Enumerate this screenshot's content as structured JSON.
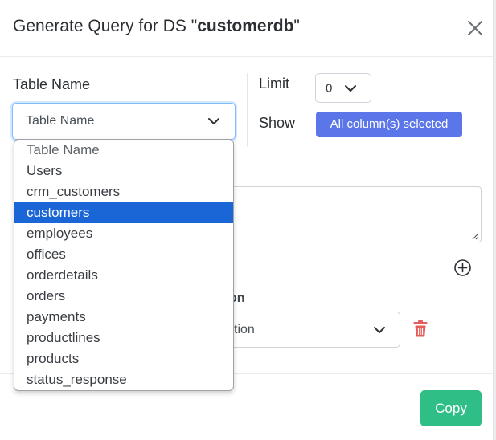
{
  "header": {
    "title_prefix": "Generate Query for DS \"",
    "datasource": "customerdb",
    "title_suffix": "\""
  },
  "form": {
    "table_name_label": "Table Name",
    "table_select_value": "Table Name",
    "limit_label": "Limit",
    "limit_value": "0",
    "show_label": "Show",
    "columns_button": "All column(s) selected",
    "condition_label_partial": "on",
    "condition_select_partial": "tion"
  },
  "dropdown": {
    "options": [
      "Table Name",
      "Users",
      "crm_customers",
      "customers",
      "employees",
      "offices",
      "orderdetails",
      "orders",
      "payments",
      "productlines",
      "products",
      "status_response"
    ],
    "highlighted": "customers"
  },
  "footer": {
    "copy_label": "Copy"
  },
  "colors": {
    "primary": "#5b76e8",
    "success": "#2fbf86",
    "danger": "#e35d5b",
    "highlight": "#1a66d6"
  }
}
